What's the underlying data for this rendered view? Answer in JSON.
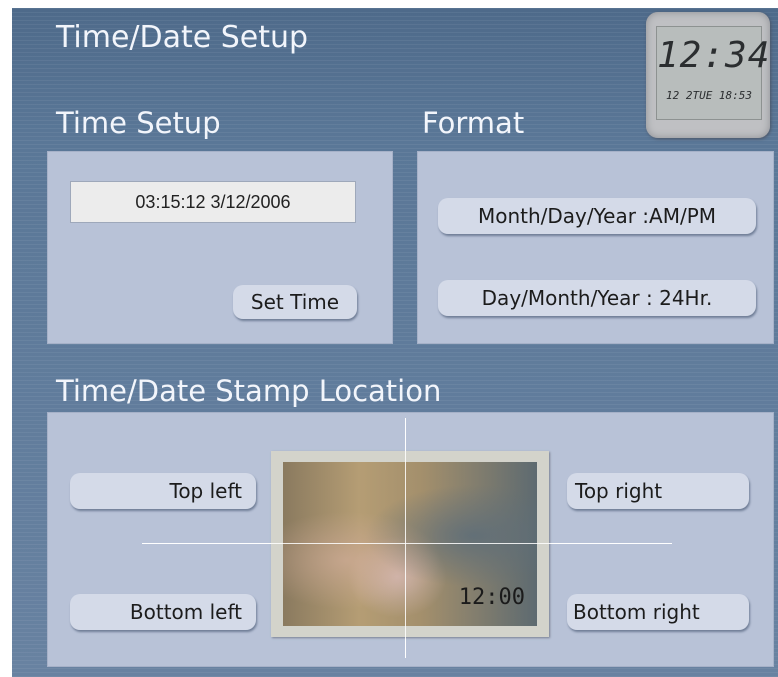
{
  "header": {
    "title": "Time/Date Setup"
  },
  "clock_widget": {
    "time": "12:34",
    "date": "12 2TUE 18:53"
  },
  "time_setup": {
    "title": "Time Setup",
    "current_value": "03:15:12  3/12/2006",
    "set_time_label": "Set Time"
  },
  "format": {
    "title": "Format",
    "options": [
      "Month/Day/Year :AM/PM",
      "Day/Month/Year : 24Hr."
    ]
  },
  "stamp_location": {
    "title": "Time/Date Stamp Location",
    "top_left": "Top left",
    "top_right": "Top right",
    "bottom_left": "Bottom left",
    "bottom_right": "Bottom right",
    "preview_stamp": "12:00"
  }
}
